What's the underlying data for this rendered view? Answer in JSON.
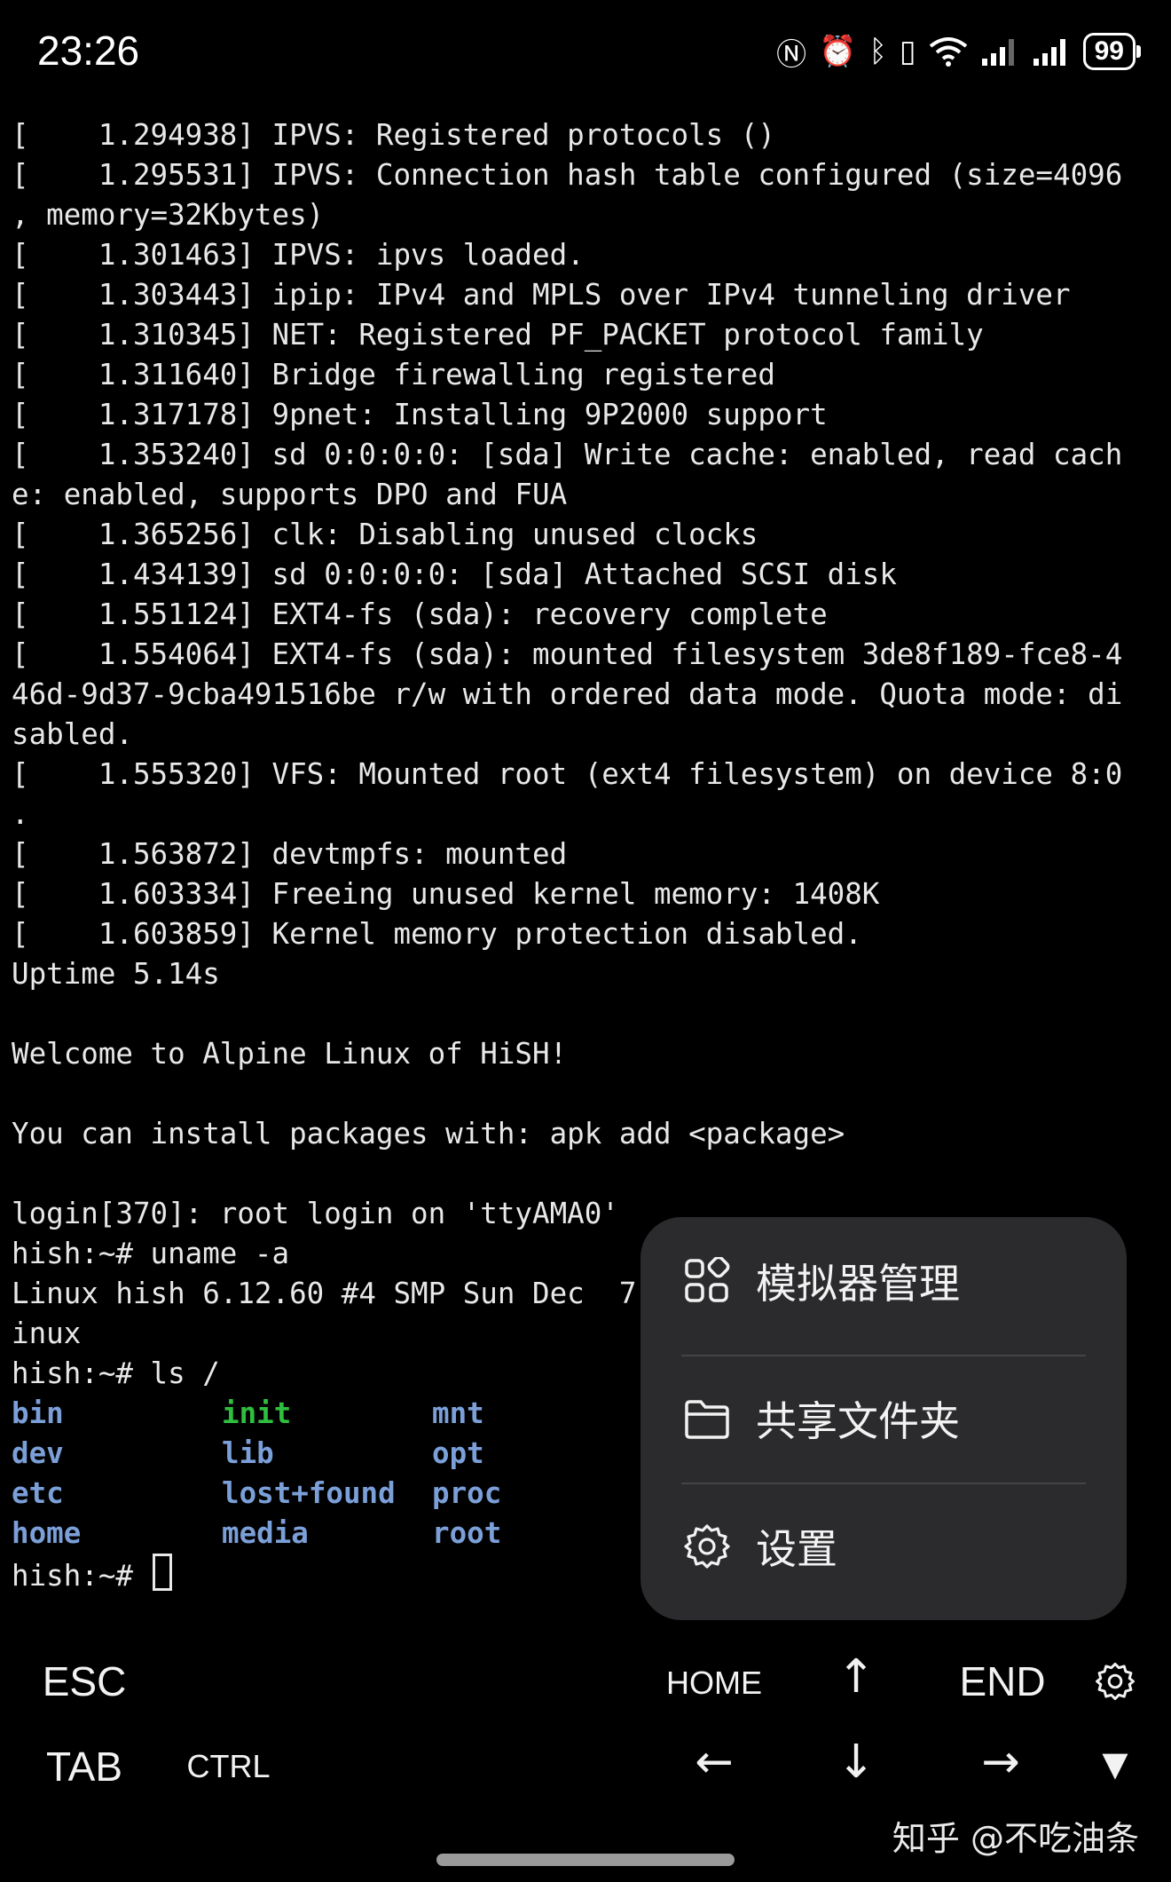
{
  "status_bar": {
    "time": "23:26",
    "icons": [
      "nfc-icon",
      "alarm-icon",
      "bluetooth-icon",
      "vibrate-icon",
      "wifi-icon",
      "signal-icon",
      "signal-icon"
    ],
    "battery": "99"
  },
  "terminal": {
    "lines": [
      "[    1.294938] IPVS: Registered protocols ()",
      "[    1.295531] IPVS: Connection hash table configured (size=4096",
      ", memory=32Kbytes)",
      "[    1.301463] IPVS: ipvs loaded.",
      "[    1.303443] ipip: IPv4 and MPLS over IPv4 tunneling driver",
      "[    1.310345] NET: Registered PF_PACKET protocol family",
      "[    1.311640] Bridge firewalling registered",
      "[    1.317178] 9pnet: Installing 9P2000 support",
      "[    1.353240] sd 0:0:0:0: [sda] Write cache: enabled, read cach",
      "e: enabled, supports DPO and FUA",
      "[    1.365256] clk: Disabling unused clocks",
      "[    1.434139] sd 0:0:0:0: [sda] Attached SCSI disk",
      "[    1.551124] EXT4-fs (sda): recovery complete",
      "[    1.554064] EXT4-fs (sda): mounted filesystem 3de8f189-fce8-4",
      "46d-9d37-9cba491516be r/w with ordered data mode. Quota mode: di",
      "sabled.",
      "[    1.555320] VFS: Mounted root (ext4 filesystem) on device 8:0",
      ".",
      "[    1.563872] devtmpfs: mounted",
      "[    1.603334] Freeing unused kernel memory: 1408K",
      "[    1.603859] Kernel memory protection disabled.",
      "Uptime 5.14s",
      "",
      "Welcome to Alpine Linux of HiSH!",
      "",
      "You can install packages with: apk add <package>",
      "",
      "login[370]: root login on 'ttyAMA0'",
      "hish:~# uname -a",
      "Linux hish 6.12.60 #4 SMP Sun Dec  7",
      "inux",
      "hish:~# ls /"
    ],
    "ls_rows": [
      [
        "bin",
        "init",
        "mnt"
      ],
      [
        "dev",
        "lib",
        "opt"
      ],
      [
        "etc",
        "lost+found",
        "proc"
      ],
      [
        "home",
        "media",
        "root"
      ]
    ],
    "prompt": "hish:~# "
  },
  "popup_menu": {
    "items": [
      {
        "label": "模拟器管理",
        "icon": "grid-icon"
      },
      {
        "label": "共享文件夹",
        "icon": "folder-icon"
      },
      {
        "label": "设置",
        "icon": "gear-icon"
      }
    ]
  },
  "extra_keys": {
    "esc": "ESC",
    "home": "HOME",
    "up": "↑",
    "end": "END",
    "settings_icon": "gear-icon",
    "tab": "TAB",
    "ctrl": "CTRL",
    "left": "←",
    "down": "↓",
    "right": "→",
    "collapse": "▼"
  },
  "watermark": "知乎 @不吃油条",
  "colors": {
    "background": "#000000",
    "directory": "#7b9fd8",
    "executable": "#2fbf3f",
    "menu_background": "#2b2b2d"
  }
}
